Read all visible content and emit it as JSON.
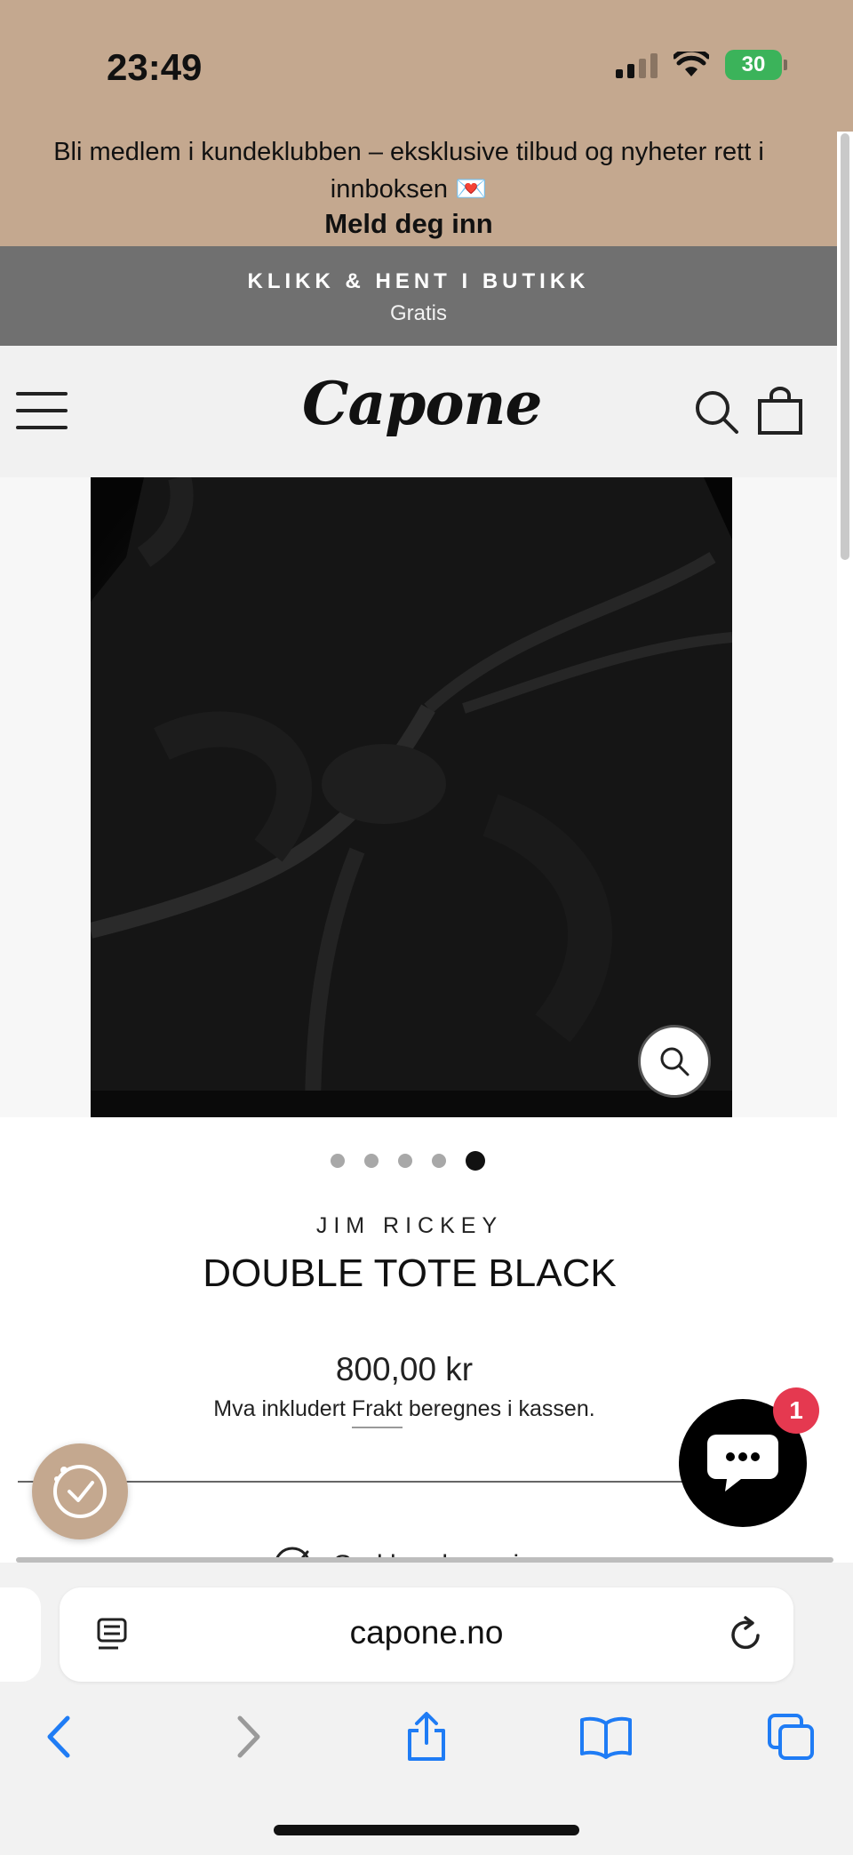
{
  "status_bar": {
    "time": "23:49",
    "battery": "30",
    "icons": [
      "cellular-signal-icon",
      "wifi-icon",
      "battery-charging-icon"
    ]
  },
  "promo": {
    "text": "Bli medlem i kundeklubben – eksklusive tilbud og nyheter rett i innboksen 💌",
    "cta": "Meld deg inn"
  },
  "pickup_banner": {
    "title": "KLIKK & HENT I BUTIKK",
    "subtitle": "Gratis"
  },
  "header": {
    "logo": "Capone",
    "icons": [
      "menu-icon",
      "search-icon",
      "shopping-bag-icon"
    ]
  },
  "gallery": {
    "total_images": 5,
    "active_index": 5,
    "zoom_icon": "zoom-icon"
  },
  "product": {
    "brand": "JIM RICKEY",
    "title": "DOUBLE TOTE BLACK",
    "price": "800,00 kr",
    "tax_prefix": "Mva inkludert",
    "tax_link": "Frakt",
    "tax_suffix": "beregnes i kassen."
  },
  "chat": {
    "badge_count": "1",
    "icon": "chat-bubble-icon"
  },
  "loyalty": {
    "icon": "loyalty-cookie-icon"
  },
  "service": {
    "label": "God kundeservice",
    "icon": "check-circle-icon"
  },
  "browser": {
    "url": "capone.no",
    "toolbar": [
      "back-icon",
      "forward-icon",
      "share-icon",
      "bookmarks-icon",
      "tabs-icon"
    ]
  },
  "colors": {
    "promo_bg": "#c4a88f",
    "pickup_bg": "#707070",
    "header_bg": "#f1f1f1",
    "chat_badge": "#e53950",
    "safari_blue": "#1f7cf5"
  }
}
